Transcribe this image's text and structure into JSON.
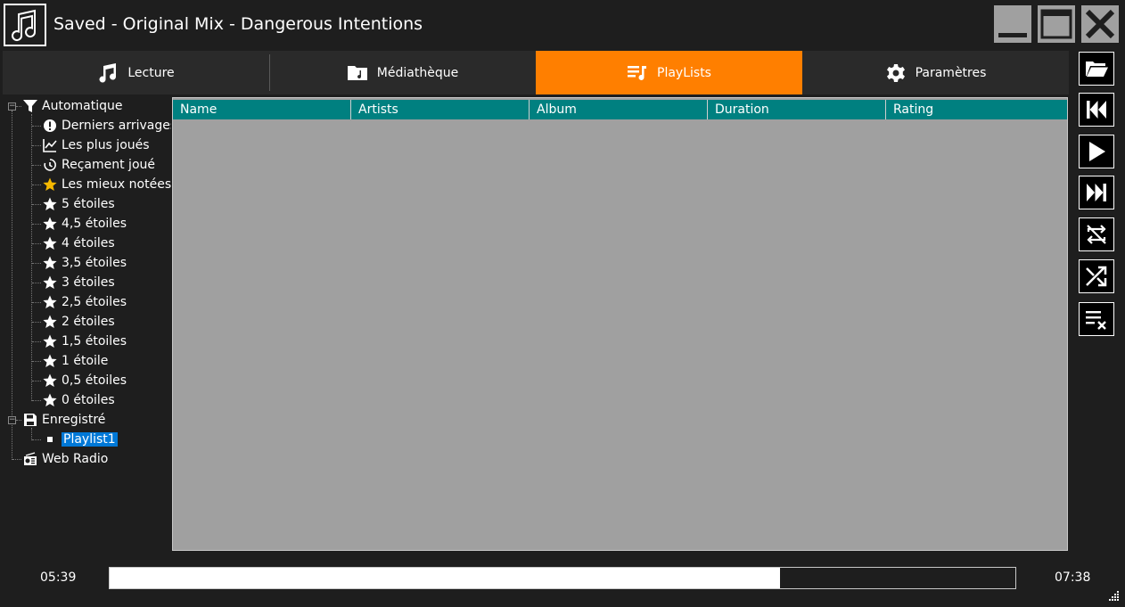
{
  "window": {
    "title": "Saved - Original Mix - Dangerous Intentions"
  },
  "tabs": [
    {
      "label": "Lecture",
      "icon": "music-note-icon"
    },
    {
      "label": "Médiathèque",
      "icon": "music-folder-icon"
    },
    {
      "label": "PlayLists",
      "icon": "playlist-icon",
      "active": true
    },
    {
      "label": "Paramètres",
      "icon": "gear-icon"
    }
  ],
  "tree": {
    "automatic": {
      "label": "Automatique",
      "items": [
        {
          "label": "Derniers arrivages",
          "icon": "new-badge-icon"
        },
        {
          "label": "Les plus joués",
          "icon": "chart-icon"
        },
        {
          "label": "Reçament joué",
          "icon": "history-icon"
        },
        {
          "label": "Les mieux notées",
          "icon": "gold-star-icon"
        },
        {
          "label": "5 étoiles",
          "icon": "star-icon"
        },
        {
          "label": "4,5 étoiles",
          "icon": "star-icon"
        },
        {
          "label": "4 étoiles",
          "icon": "star-icon"
        },
        {
          "label": "3,5 étoiles",
          "icon": "star-icon"
        },
        {
          "label": "3 étoiles",
          "icon": "star-icon"
        },
        {
          "label": "2,5 étoiles",
          "icon": "star-icon"
        },
        {
          "label": "2 étoiles",
          "icon": "star-icon"
        },
        {
          "label": "1,5 étoiles",
          "icon": "star-icon"
        },
        {
          "label": "1 étoile",
          "icon": "star-icon"
        },
        {
          "label": "0,5 étoiles",
          "icon": "star-icon"
        },
        {
          "label": "0 étoiles",
          "icon": "star-icon"
        }
      ]
    },
    "saved": {
      "label": "Enregistré",
      "items": [
        {
          "label": "Playlist1",
          "selected": true
        }
      ]
    },
    "webradio": {
      "label": "Web Radio"
    }
  },
  "grid": {
    "columns": [
      "Name",
      "Artists",
      "Album",
      "Duration",
      "Rating"
    ]
  },
  "controls": [
    "open-folder-icon",
    "previous-icon",
    "play-icon",
    "next-icon",
    "repeat-off-icon",
    "shuffle-icon",
    "clear-playlist-icon"
  ],
  "player": {
    "elapsed": "05:39",
    "total": "07:38",
    "progress": 0.74
  },
  "colors": {
    "accent": "#ff7f00",
    "header": "#008080",
    "grid_bg": "#a0a0a0",
    "selection": "#0078d7"
  }
}
